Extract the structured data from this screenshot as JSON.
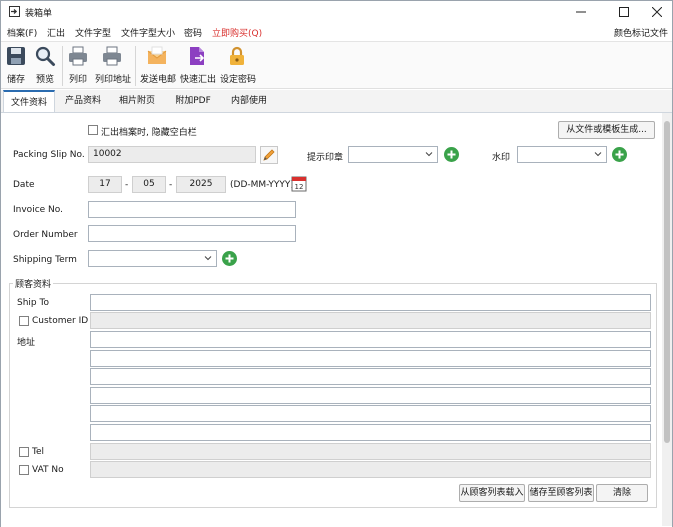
{
  "window": {
    "title": "装箱单"
  },
  "menu": {
    "items": [
      "档案(F)",
      "汇出",
      "文件字型",
      "文件字型大小",
      "密码",
      "立即购买(Q)"
    ],
    "right": "颜色标记文件",
    "buy_color": "#d9302e"
  },
  "toolbar": {
    "save": "储存",
    "preview": "预览",
    "print": "列印",
    "print_address": "列印地址",
    "send_email": "发送电邮",
    "quick_export": "快速汇出",
    "set_password": "设定密码"
  },
  "tabs": [
    "文件资料",
    "产品资料",
    "相片附页",
    "附加PDF",
    "内部使用"
  ],
  "form": {
    "hide_blank_label": "汇出档案时, 隐藏空白栏",
    "generate_button": "从文件或模板生成...",
    "packing_slip_label": "Packing Slip No.",
    "packing_slip_value": "10002",
    "stamp_label": "提示印章",
    "watermark_label": "水印",
    "date_label": "Date",
    "date_day": "17",
    "date_month": "05",
    "date_year": "2025",
    "date_sep": "-",
    "date_format": "(DD-MM-YYYY)",
    "calendar_day": "12",
    "invoice_label": "Invoice No.",
    "order_label": "Order Number",
    "shipping_label": "Shipping Term"
  },
  "customer": {
    "group_title": "顾客资料",
    "ship_to": "Ship To",
    "customer_id": "Customer ID",
    "address": "地址",
    "tel": "Tel",
    "vat": "VAT No",
    "load_button": "从顾客列表载入",
    "save_button": "储存至顾客列表",
    "clear_button": "清除"
  }
}
